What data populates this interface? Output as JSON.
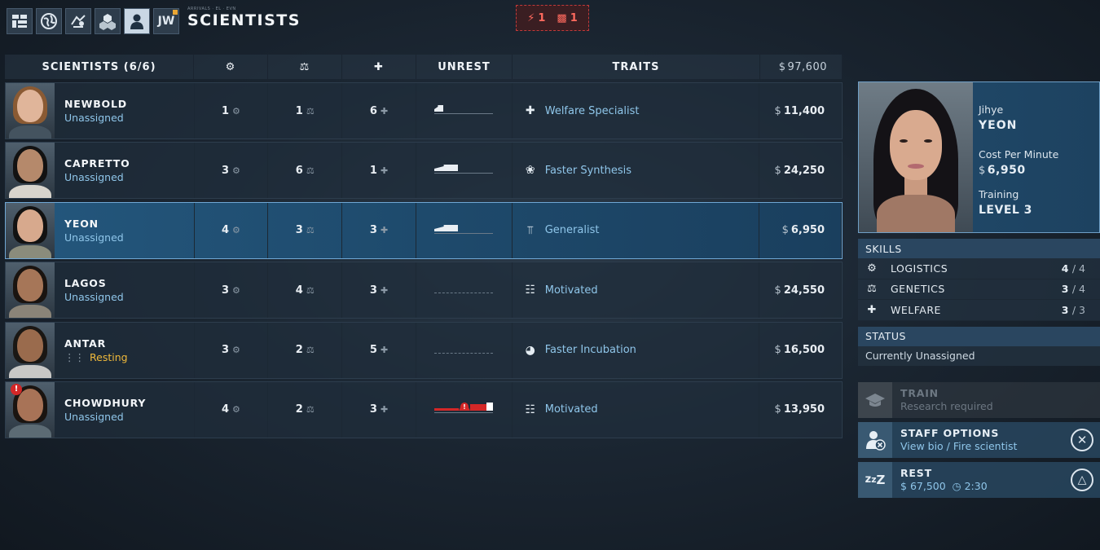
{
  "header": {
    "title": "SCIENTISTS",
    "small_caption": "ARRIVALS · EL · EVN",
    "alerts": [
      {
        "icon": "lightning-icon",
        "count": "1"
      },
      {
        "icon": "cargo-icon",
        "count": "1"
      }
    ],
    "nav_icons": [
      "facility-grid-icon",
      "globe-icon",
      "expedition-icon",
      "resources-icon",
      "scientist-icon",
      "jw-logo-icon"
    ],
    "jw_label": "JW"
  },
  "table": {
    "columns": {
      "name": "SCIENTISTS (6/6)",
      "logistics_icon": "gear-icon",
      "genetics_icon": "flask-icon",
      "welfare_icon": "plus-icon",
      "unrest": "UNREST",
      "traits": "TRAITS",
      "total_cost_currency": "$",
      "total_cost": "97,600"
    },
    "rows": [
      {
        "name": "NEWBOLD",
        "status": "Unassigned",
        "logistics": "1",
        "genetics": "1",
        "welfare": "6",
        "unrest_level": 0.15,
        "trait": "Welfare Specialist",
        "trait_icon": "welfare-specialist-icon",
        "cost": "11,400"
      },
      {
        "name": "CAPRETTO",
        "status": "Unassigned",
        "logistics": "3",
        "genetics": "6",
        "welfare": "1",
        "unrest_level": 0.4,
        "trait": "Faster Synthesis",
        "trait_icon": "synthesis-icon",
        "cost": "24,250"
      },
      {
        "name": "YEON",
        "status": "Unassigned",
        "logistics": "4",
        "genetics": "3",
        "welfare": "3",
        "unrest_level": 0.4,
        "trait": "Generalist",
        "trait_icon": "generalist-icon",
        "cost": "6,950"
      },
      {
        "name": "LAGOS",
        "status": "Unassigned",
        "logistics": "3",
        "genetics": "4",
        "welfare": "3",
        "unrest_level": 0.0,
        "trait": "Motivated",
        "trait_icon": "motivated-icon",
        "cost": "24,550"
      },
      {
        "name": "ANTAR",
        "status": "Resting",
        "logistics": "3",
        "genetics": "2",
        "welfare": "5",
        "unrest_level": 0.0,
        "trait": "Faster Incubation",
        "trait_icon": "incubation-icon",
        "cost": "16,500"
      },
      {
        "name": "CHOWDHURY",
        "status": "Unassigned",
        "logistics": "4",
        "genetics": "2",
        "welfare": "3",
        "unrest_level": 1.0,
        "trait": "Motivated",
        "trait_icon": "motivated-icon",
        "cost": "13,950"
      }
    ]
  },
  "selected": {
    "first_name": "Jihye",
    "last_name": "YEON",
    "cost_label": "Cost Per Minute",
    "cost_currency": "$",
    "cost": "6,950",
    "training_label": "Training",
    "training_level": "LEVEL 3"
  },
  "skills": {
    "header": "SKILLS",
    "items": [
      {
        "icon": "gear-icon",
        "name": "LOGISTICS",
        "value": "4",
        "max": "/ 4"
      },
      {
        "icon": "flask-icon",
        "name": "GENETICS",
        "value": "3",
        "max": "/ 4"
      },
      {
        "icon": "plus-icon",
        "name": "WELFARE",
        "value": "3",
        "max": "/ 3"
      }
    ]
  },
  "status": {
    "header": "STATUS",
    "value": "Currently Unassigned"
  },
  "actions": {
    "train": {
      "title": "TRAIN",
      "subtitle": "Research required",
      "icon": "graduation-cap-icon"
    },
    "staff": {
      "title": "STAFF OPTIONS",
      "subtitle": "View bio / Fire scientist",
      "icon": "staff-options-icon",
      "button": "cross-button-icon"
    },
    "rest": {
      "title": "REST",
      "cost_currency": "$",
      "cost": "67,500",
      "time": "2:30",
      "icon": "sleep-icon",
      "button": "triangle-button-icon"
    }
  },
  "colors": {
    "accent_blue": "#8fc6ea",
    "selected_row": "#1e4a6c",
    "resting": "#efb93b",
    "unrest_high": "#d42727"
  }
}
